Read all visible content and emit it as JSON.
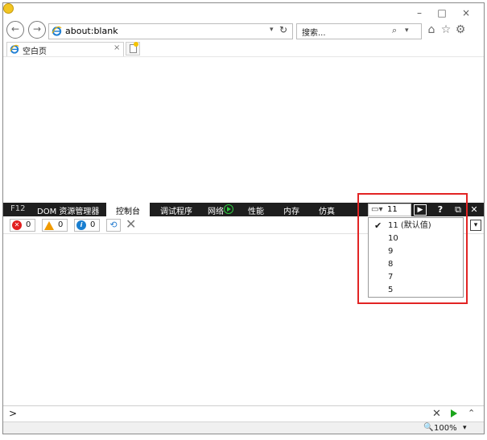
{
  "window": {
    "controls": {
      "minimize": "–",
      "maximize": "□",
      "close": "×"
    }
  },
  "nav": {
    "back_icon": "←",
    "forward_icon": "→",
    "address": "about:blank",
    "address_dropdown": "▾",
    "refresh_icon": "↻",
    "search_placeholder": "搜索...",
    "search_icon": "⌕",
    "search_dropdown": "▾",
    "home_icon": "⌂",
    "favorites_icon": "☆",
    "tools_icon": "⚙"
  },
  "tabs": [
    {
      "title": "空白页",
      "close": "×"
    }
  ],
  "devtools": {
    "tabs": [
      "F12",
      "DOM 资源管理器",
      "控制台",
      "调试程序",
      "网络",
      "性能",
      "内存",
      "仿真"
    ],
    "active_tab": "控制台",
    "document_mode": "11",
    "document_mode_icon": "▭▾",
    "console_toggle": "▶",
    "help": "?",
    "undock": "⧉",
    "close": "✕",
    "filters": {
      "errors": 0,
      "warnings": 0,
      "messages": 0,
      "error_icon": "✕",
      "warning_icon": "!",
      "message_icon": "i"
    },
    "clear_on_nav_icon": "⟲",
    "clear_icon": "✕",
    "target_dropdown": "▾",
    "document_mode_menu": [
      {
        "label": "11 (默认值)",
        "checked": true,
        "check": "✔"
      },
      {
        "label": "10",
        "checked": false
      },
      {
        "label": "9",
        "checked": false
      },
      {
        "label": "8",
        "checked": false
      },
      {
        "label": "7",
        "checked": false
      },
      {
        "label": "5",
        "checked": false
      }
    ],
    "console_prompt": ">",
    "console_clear": "✕",
    "console_expand": "⌃"
  },
  "status": {
    "zoom_icon": "🔍",
    "zoom": "100%",
    "zoom_dropdown": "▾"
  },
  "colors": {
    "devtools_bar": "#1e1e1e",
    "highlight": "#e22424",
    "error": "#e21f1f",
    "warning": "#f09a00",
    "info": "#1a7fd0",
    "run": "#1aa51a"
  }
}
